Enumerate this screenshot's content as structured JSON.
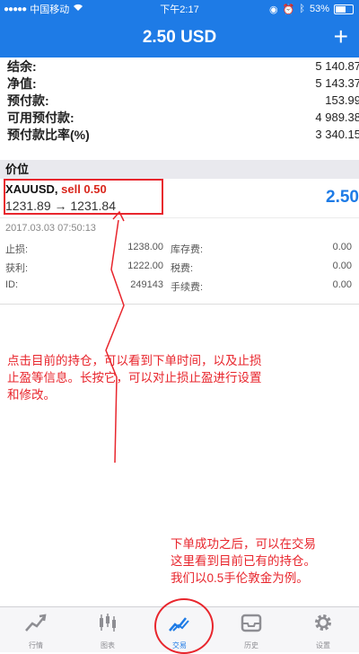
{
  "status_bar": {
    "carrier": "中国移动",
    "time": "下午2:17",
    "battery": "53%"
  },
  "nav": {
    "title": "2.50 USD",
    "add_label": "+"
  },
  "summary": [
    {
      "label": "结余:",
      "value": "5 140.87"
    },
    {
      "label": "净值:",
      "value": "5 143.37"
    },
    {
      "label": "预付款:",
      "value": "153.99"
    },
    {
      "label": "可用预付款:",
      "value": "4 989.38"
    },
    {
      "label": "预付款比率(%)",
      "value": "3 340.15"
    }
  ],
  "section": {
    "title": "价位"
  },
  "position": {
    "symbol": "XAUUSD,",
    "side": "sell 0.50",
    "prices": "1231.89 → 1231.84",
    "profit": "2.50",
    "time": "2017.03.03 07:50:13",
    "details": {
      "stop_loss_label": "止损:",
      "stop_loss": "1238.00",
      "swap_label": "库存费:",
      "swap": "0.00",
      "take_profit_label": "获利:",
      "take_profit": "1222.00",
      "tax_label": "税费:",
      "tax": "0.00",
      "id_label": "ID:",
      "id": "249143",
      "commission_label": "手续费:",
      "commission": "0.00"
    }
  },
  "annotations": {
    "note1": [
      "点击目前的持仓，可以看到下单时间，以及止损",
      "止盈等信息。长按它，可以对止损止盈进行设置",
      "和修改。"
    ],
    "note2": [
      "下单成功之后，可以在交易",
      "这里看到目前已有的持仓。",
      "我们以0.5手伦敦金为例。"
    ]
  },
  "tabs": [
    {
      "label": "行情",
      "icon": "chart-icon",
      "active": false
    },
    {
      "label": "图表",
      "icon": "candles-icon",
      "active": false
    },
    {
      "label": "交易",
      "icon": "trade-icon",
      "active": true
    },
    {
      "label": "历史",
      "icon": "inbox-icon",
      "active": false
    },
    {
      "label": "设置",
      "icon": "gear-icon",
      "active": false
    }
  ],
  "colors": {
    "accent": "#1e7be6",
    "annotation": "#e8262d",
    "sell": "#d9261c"
  }
}
